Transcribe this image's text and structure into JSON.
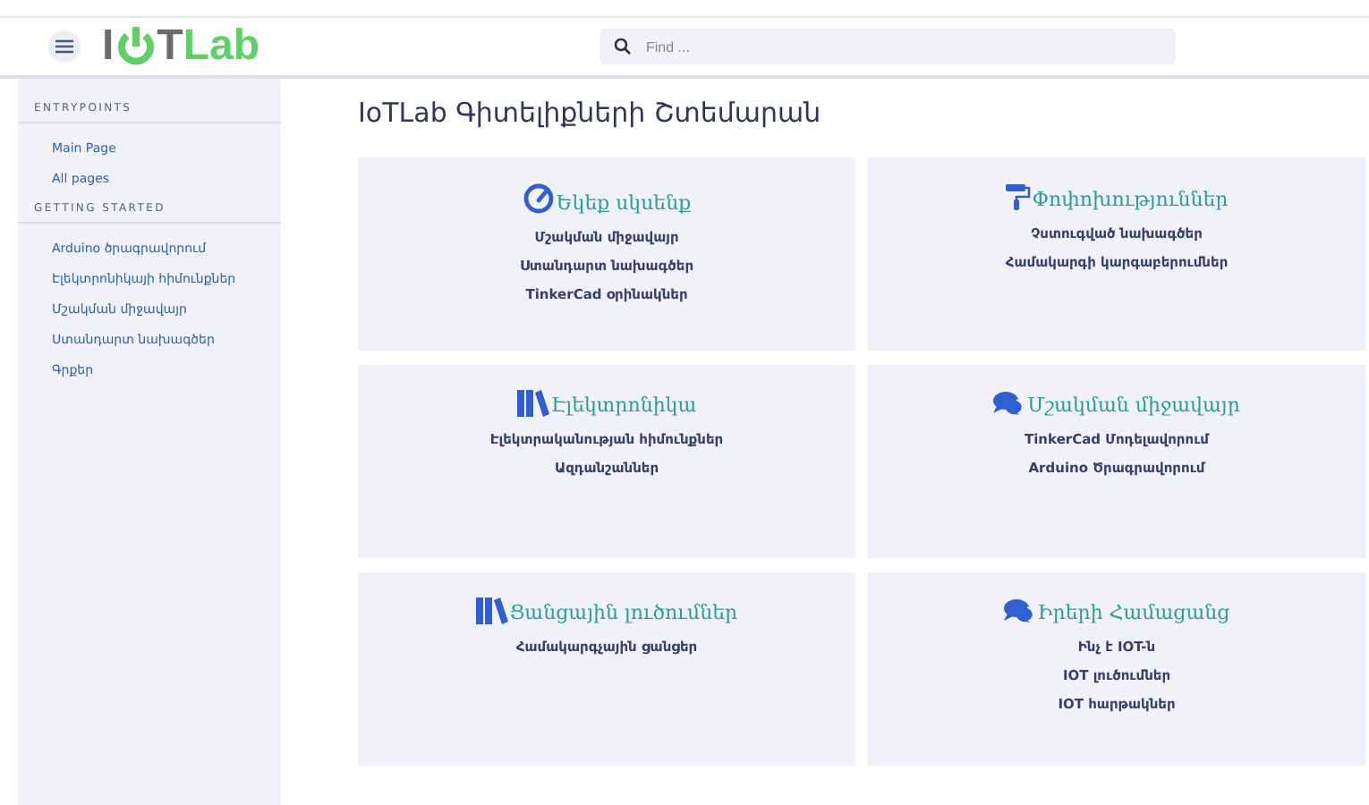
{
  "header": {
    "logo": {
      "first": "I",
      "second": "T",
      "accent": "Lab"
    },
    "search": {
      "placeholder": "Find ..."
    }
  },
  "sidebar": {
    "sections": [
      {
        "title": "ENTRYPOINTS",
        "items": [
          "Main Page",
          "All pages"
        ]
      },
      {
        "title": "GETTING STARTED",
        "items": [
          "Arduino ծրագրավորում",
          "Էլեկտրոնիկայի հիմունքներ",
          "Մշակման միջավայր",
          "Ստանդարտ նախագծեր",
          "Գրքեր"
        ]
      }
    ]
  },
  "page": {
    "title": "IoTLab Գիտելիքների Շտեմարան",
    "cards": [
      {
        "kind": "gauge",
        "title": "Եկեք սկսենք",
        "links": [
          "Մշակման միջավայր",
          "Ստանդարտ նախագծեր",
          "TinkerCad օրինակներ"
        ]
      },
      {
        "kind": "roller",
        "title": "Փոփոխություններ",
        "links": [
          "Չստուգված նախագծեր",
          "Համակարգի կարգաբերումներ"
        ]
      },
      {
        "kind": "books",
        "title": "Էլեկտրոնիկա",
        "links": [
          "Էլեկտրականության հիմունքներ",
          "Ազդանշաններ"
        ]
      },
      {
        "kind": "comments",
        "title": "Մշակման միջավայր",
        "links": [
          "TinkerCad Մոդելավորում",
          "Arduino Ծրագրավորում"
        ]
      },
      {
        "kind": "books",
        "title": "Ցանցային լուծումներ",
        "links": [
          "Համակարգչային ցանցեր"
        ]
      },
      {
        "kind": "comments",
        "title": "Իրերի Համացանց",
        "links": [
          "Ինչ է IOT-ն",
          "IOT լուծումներ",
          "IOT հարթակներ"
        ]
      }
    ]
  }
}
